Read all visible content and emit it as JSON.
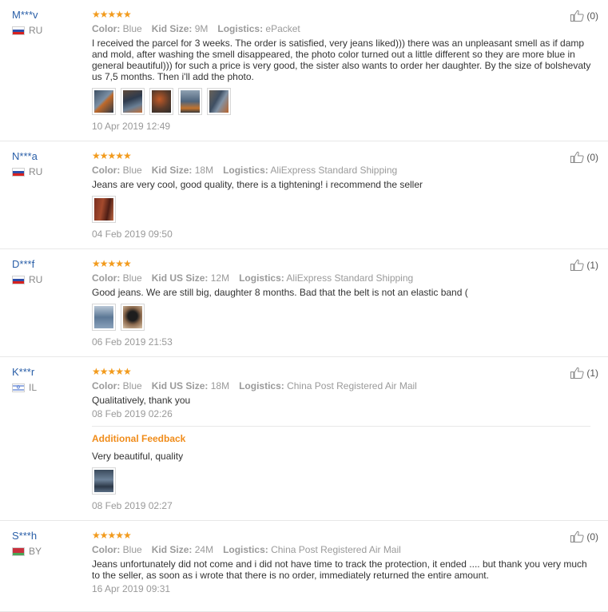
{
  "reviews": [
    {
      "user": "M***v",
      "country": "RU",
      "flag": "flag-ru",
      "stars": "★★★★★",
      "attrs": [
        {
          "label": "Color:",
          "value": "Blue"
        },
        {
          "label": "Kid Size:",
          "value": "9M"
        },
        {
          "label": "Logistics:",
          "value": "ePacket"
        }
      ],
      "text": "I received the parcel for 3 weeks. The order is satisfied, very jeans liked))) there was an unpleasant smell as if damp and mold, after washing the smell disappeared, the photo color turned out a little different so they are more blue in general beautiful))) for such a price is very good, the sister also wants to order her daughter. By the size of bolshevaty us 7,5 months. Then i'll add the photo.",
      "photos": [
        "t1",
        "t2",
        "t3",
        "t4",
        "t5"
      ],
      "date": "10 Apr 2019 12:49",
      "helpful": "(0)"
    },
    {
      "user": "N***a",
      "country": "RU",
      "flag": "flag-ru",
      "stars": "★★★★★",
      "attrs": [
        {
          "label": "Color:",
          "value": "Blue"
        },
        {
          "label": "Kid Size:",
          "value": "18M"
        },
        {
          "label": "Logistics:",
          "value": "AliExpress Standard Shipping"
        }
      ],
      "text": "Jeans are very cool, good quality, there is a tightening! i recommend the seller",
      "photos": [
        "t6"
      ],
      "date": "04 Feb 2019 09:50",
      "helpful": "(0)"
    },
    {
      "user": "D***f",
      "country": "RU",
      "flag": "flag-ru",
      "stars": "★★★★★",
      "attrs": [
        {
          "label": "Color:",
          "value": "Blue"
        },
        {
          "label": "Kid US Size:",
          "value": "12M"
        },
        {
          "label": "Logistics:",
          "value": "AliExpress Standard Shipping"
        }
      ],
      "text": "Good jeans. We are still big, daughter 8 months. Bad that the belt is not an elastic band (",
      "photos": [
        "t7",
        "t8"
      ],
      "date": "06 Feb 2019 21:53",
      "helpful": "(1)"
    },
    {
      "user": "K***r",
      "country": "IL",
      "flag": "flag-il",
      "stars": "★★★★★",
      "attrs": [
        {
          "label": "Color:",
          "value": "Blue"
        },
        {
          "label": "Kid US Size:",
          "value": "18M"
        },
        {
          "label": "Logistics:",
          "value": "China Post Registered Air Mail"
        }
      ],
      "text": "Qualitatively, thank you",
      "photos": [],
      "date": "08 Feb 2019 02:26",
      "helpful": "(1)",
      "additional": {
        "title": "Additional Feedback",
        "text": "Very beautiful, quality",
        "photos": [
          "t9"
        ],
        "date": "08 Feb 2019 02:27"
      }
    },
    {
      "user": "S***h",
      "country": "BY",
      "flag": "flag-by",
      "stars": "★★★★★",
      "attrs": [
        {
          "label": "Color:",
          "value": "Blue"
        },
        {
          "label": "Kid Size:",
          "value": "24M"
        },
        {
          "label": "Logistics:",
          "value": "China Post Registered Air Mail"
        }
      ],
      "text": "Jeans unfortunately did not come and i did not have time to track the protection, it ended .... but thank you very much to the seller, as soon as i wrote that there is no order, immediately returned the entire amount.",
      "photos": [],
      "date": "16 Apr 2019 09:31",
      "helpful": "(0)"
    }
  ],
  "colors": {
    "username": "#2a5fa8",
    "stars": "#f29b1d",
    "additional_feedback": "#f08c1a",
    "muted": "#9a9a9a"
  },
  "icons": {
    "helpful": "thumbs-up-icon"
  }
}
